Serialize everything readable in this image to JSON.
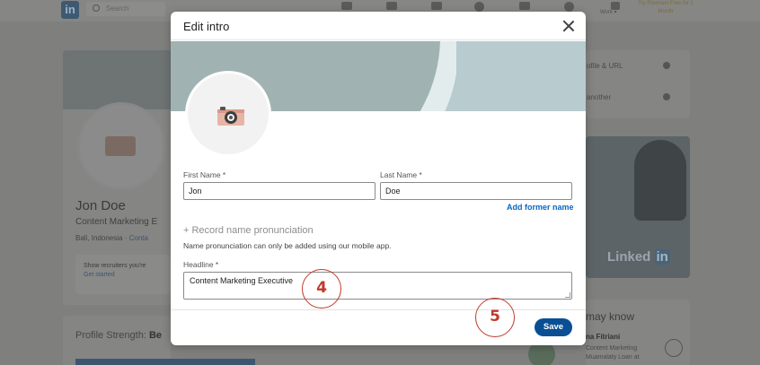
{
  "background_page": {
    "search_placeholder": "Search",
    "work_label": "Work ▾",
    "premium_label": "Try Premium Free for 1 Month",
    "profile_name": "Jon Doe",
    "profile_headline": "Content Marketing E",
    "profile_location": "Bali, Indonesia",
    "contact_link": "Conta",
    "recruiters_text": "Show recruiters you're",
    "get_started": "Get started",
    "strength_label": "Profile Strength:",
    "strength_value": "Be",
    "right_items": [
      "ofile & URL",
      "another"
    ],
    "ad_brand": "Linked",
    "ad_brand_box": "in",
    "may_know_title": "may know",
    "suggested_person_name": "na Fitriani",
    "suggested_person_title": "Content Marketing",
    "suggested_person_company": "Muamalaty Loan at"
  },
  "modal": {
    "title": "Edit intro",
    "first_name": {
      "label": "First Name *",
      "value": "Jon"
    },
    "last_name": {
      "label": "Last Name *",
      "value": "Doe"
    },
    "add_former_name": "Add former name",
    "record_pronunciation": "+ Record name pronunciation",
    "pronunciation_note": "Name pronunciation can only be added using our mobile app.",
    "headline": {
      "label": "Headline *",
      "value": "Content Marketing Executive"
    },
    "save_label": "Save"
  },
  "annotations": [
    {
      "number": "4"
    },
    {
      "number": "5"
    }
  ],
  "colors": {
    "accent": "#0a66c2",
    "save_button": "#0a4f94",
    "annotation": "#c0392b"
  },
  "icons": [
    "linkedin-logo",
    "search-icon",
    "close-icon",
    "camera-icon"
  ]
}
